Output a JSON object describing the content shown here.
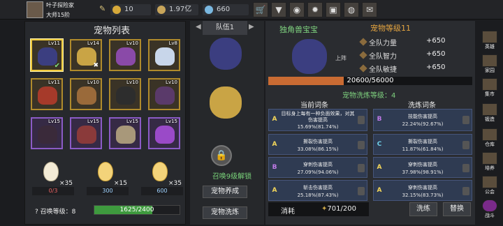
{
  "header": {
    "player_name": "叶子探险家",
    "rank": "大师15阶",
    "gold": "10",
    "coins": "1.97亿",
    "gems": "660"
  },
  "pet_list": {
    "title": "宠物列表",
    "pets": [
      {
        "level": "Lv11"
      },
      {
        "level": "Lv14"
      },
      {
        "level": "Lv10"
      },
      {
        "level": "Lv8"
      },
      {
        "level": "Lv11"
      },
      {
        "level": "Lv10"
      },
      {
        "level": "Lv10"
      },
      {
        "level": "Lv10"
      },
      {
        "level": "Lv15"
      },
      {
        "level": "Lv15"
      },
      {
        "level": "Lv15"
      },
      {
        "level": "Lv15"
      }
    ]
  },
  "eggs": [
    {
      "count": "×35",
      "have": "0/3"
    },
    {
      "count": "×15",
      "have": "300"
    },
    {
      "count": "×35",
      "have": "600"
    }
  ],
  "summon": {
    "label": "召唤等级：",
    "level": "8",
    "progress": "1625/2400",
    "fraction": 0.68
  },
  "team": {
    "tab": "队伍1",
    "unlock_text": "召唤9级解锁",
    "btn_swap": "宠物养成",
    "btn_wash": "宠物洗炼"
  },
  "detail": {
    "name": "独角兽宝宝",
    "level": "宠物等级11",
    "deploy": "上阵",
    "stats": [
      {
        "label": "全队力量",
        "value": "+650"
      },
      {
        "label": "全队智力",
        "value": "+650"
      },
      {
        "label": "全队敏捷",
        "value": "+650"
      }
    ],
    "exp": "20600/56000",
    "exp_fraction": 0.37,
    "wash_level": "宠物洗炼等级：4",
    "current_title": "当前词条",
    "wash_title": "洗炼词条",
    "current": [
      {
        "grade": "A",
        "text": "目标身上每有一种负面效果，对其伤害提高",
        "value": "15.69%(81.74%)"
      },
      {
        "grade": "A",
        "text": "撕裂伤害提高",
        "value": "33.08%(86.15%)"
      },
      {
        "grade": "B",
        "text": "穿刺伤害提高",
        "value": "27.09%(94.06%)"
      },
      {
        "grade": "A",
        "text": "斩击伤害提高",
        "value": "25.18%(87.43%)"
      }
    ],
    "wash": [
      {
        "grade": "B",
        "text": "技能伤害提高",
        "value": "22.24%(92.67%)"
      },
      {
        "grade": "C",
        "text": "撕裂伤害提高",
        "value": "11.87%(61.84%)"
      },
      {
        "grade": "A",
        "text": "穿刺伤害提高",
        "value": "37.98%(98.91%)"
      },
      {
        "grade": "A",
        "text": "穿刺伤害提高",
        "value": "32.15%(83.73%)"
      }
    ],
    "cost_label": "消耗",
    "cost_value": "701/200",
    "btn_wash": "洗练",
    "btn_replace": "替换"
  },
  "side_nav": [
    "英雄",
    "家园",
    "集市",
    "锻造",
    "仓库",
    "培养",
    "公会",
    "战斗"
  ]
}
